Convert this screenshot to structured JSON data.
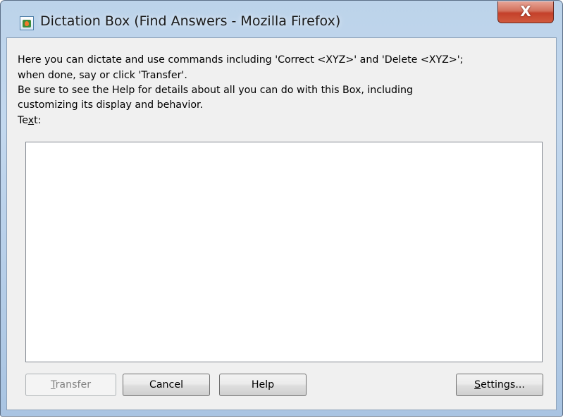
{
  "window": {
    "title": "Dictation Box (Find Answers - Mozilla Firefox)",
    "close_label": "X",
    "icon": "dragon-dictation-icon"
  },
  "instructions": {
    "line1": "Here you can dictate and use commands including 'Correct <XYZ>' and 'Delete <XYZ>';",
    "line2": "when done, say or click 'Transfer'.",
    "line3": "Be sure to see the Help for details about all you can do with this Box, including",
    "line4": "customizing its display and behavior."
  },
  "text_field": {
    "label_before": "Te",
    "label_accel": "x",
    "label_after": "t:",
    "value": ""
  },
  "buttons": {
    "transfer": {
      "accel": "T",
      "rest": "ransfer",
      "enabled": false
    },
    "cancel": {
      "label": "Cancel"
    },
    "help": {
      "label": "Help"
    },
    "settings": {
      "accel": "S",
      "rest": "ettings..."
    }
  }
}
